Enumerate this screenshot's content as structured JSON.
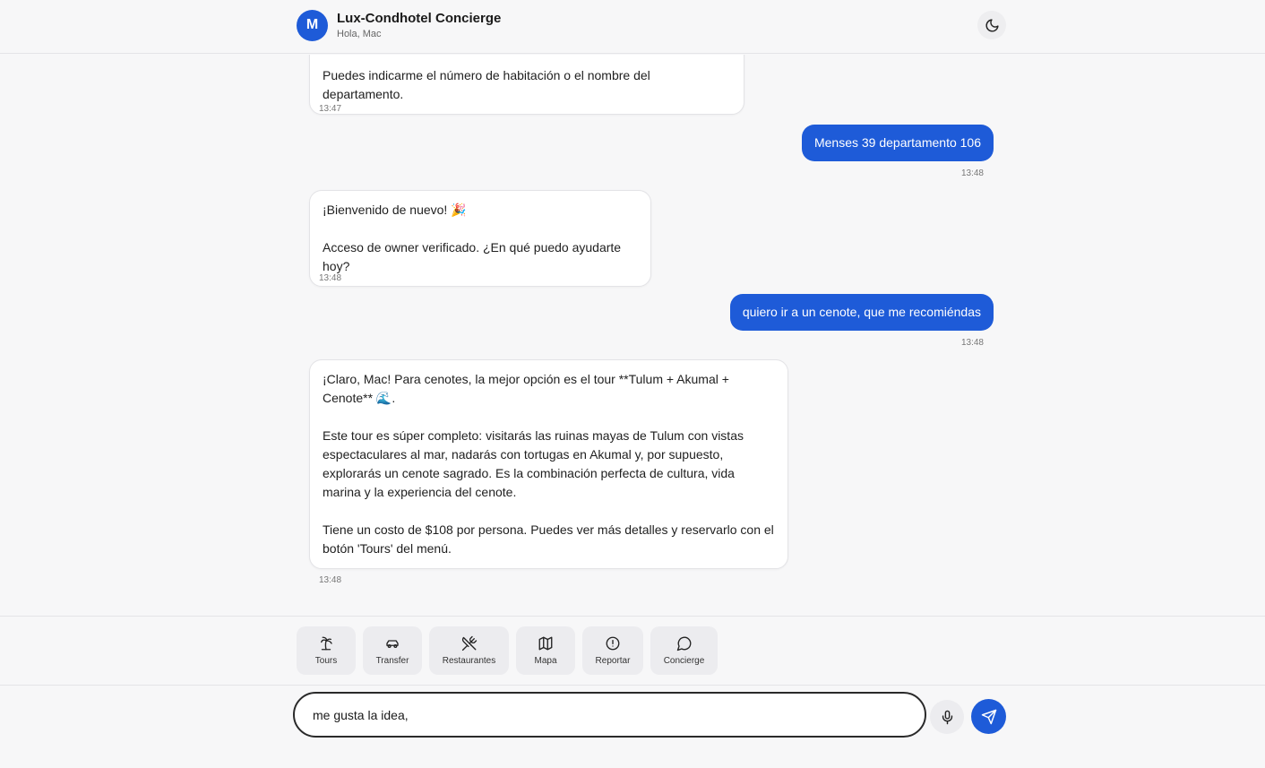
{
  "header": {
    "avatar_initial": "M",
    "title": "Lux-Condhotel Concierge",
    "greeting": "Hola, Mac",
    "theme_icon": "moon-icon"
  },
  "messages": [
    {
      "role": "bot",
      "text": "Puedes indicarme el número de habitación o el nombre del departamento.",
      "time": "13:47"
    },
    {
      "role": "user",
      "text": "Menses 39 departamento 106",
      "time": "13:48"
    },
    {
      "role": "bot",
      "text": "¡Bienvenido de nuevo! 🎉\n\nAcceso de owner verificado. ¿En qué puedo ayudarte hoy?",
      "time": "13:48"
    },
    {
      "role": "user",
      "text": "quiero ir a un cenote, que me recomiéndas",
      "time": "13:48"
    },
    {
      "role": "bot",
      "text": "¡Claro, Mac! Para cenotes, la mejor opción es el tour **Tulum + Akumal + Cenote** 🌊.\n\nEste tour es súper completo: visitarás las ruinas mayas de Tulum con vistas espectaculares al mar, nadarás con tortugas en Akumal y, por supuesto, explorarás un cenote sagrado. Es la combinación perfecta de cultura, vida marina y la experiencia del cenote.\n\nTiene un costo de $108 por persona. Puedes ver más detalles y reservarlo con el botón 'Tours' del menú.",
      "time": "13:48"
    }
  ],
  "quick_actions": [
    {
      "label": "Tours",
      "icon": "palm-tree-icon"
    },
    {
      "label": "Transfer",
      "icon": "car-icon"
    },
    {
      "label": "Restaurantes",
      "icon": "utensils-crossed-icon"
    },
    {
      "label": "Mapa",
      "icon": "map-icon"
    },
    {
      "label": "Reportar",
      "icon": "alert-circle-icon"
    },
    {
      "label": "Concierge",
      "icon": "chat-bubble-icon"
    }
  ],
  "composer": {
    "value": "me gusta la idea, ",
    "mic_icon": "microphone-icon",
    "send_icon": "send-icon"
  },
  "colors": {
    "accent": "#1e5bd8",
    "background": "#f7f7f8",
    "bot_bubble": "#ffffff"
  }
}
